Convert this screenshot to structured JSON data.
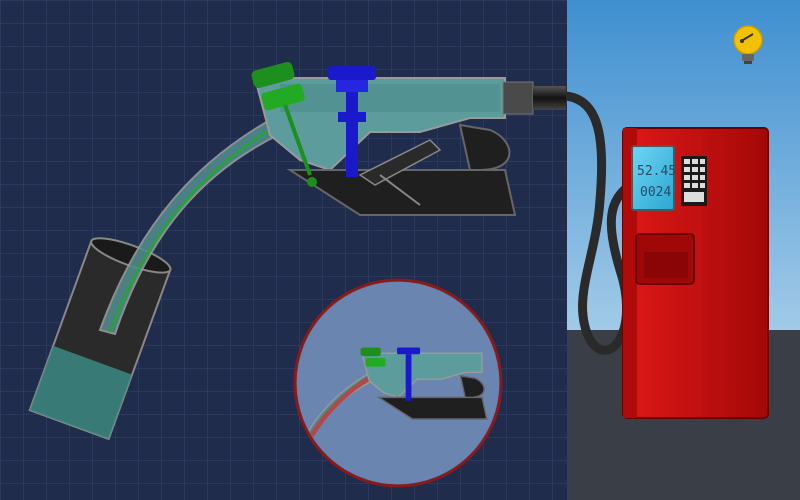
{
  "scene": {
    "title": "",
    "blueprint_bg": "#1f2c4c",
    "grid_color": "#2f3f63",
    "sky_top": "#3f8fd0",
    "sky_bottom": "#cfe6f3",
    "ground_color": "#3a3e47"
  },
  "nozzle": {
    "body_color": "#5c9c9c",
    "outline_color": "#8a8a8a",
    "trigger_color": "#1f1f1f",
    "valve_color": "#1a1acc",
    "sensor_color": "#22aa22",
    "hose_color": "#2a2a2a"
  },
  "tank": {
    "fuel_color": "#3b8a84",
    "glass_color": "#1a1a1a",
    "fill_fraction": 0.38
  },
  "inset": {
    "name": "zoom-view",
    "border_color": "#8a1a1a",
    "bg": "#5a78a8",
    "flow_color": "#b04a4a"
  },
  "pump": {
    "body_color": "#cc1010",
    "screen_color": "#2fb7e0",
    "readout_top": "52.45",
    "readout_bottom": "0024",
    "keypad_color": "#e8e8e8"
  },
  "hint_button": {
    "icon": "lightbulb-icon",
    "color": "#f2c200"
  }
}
